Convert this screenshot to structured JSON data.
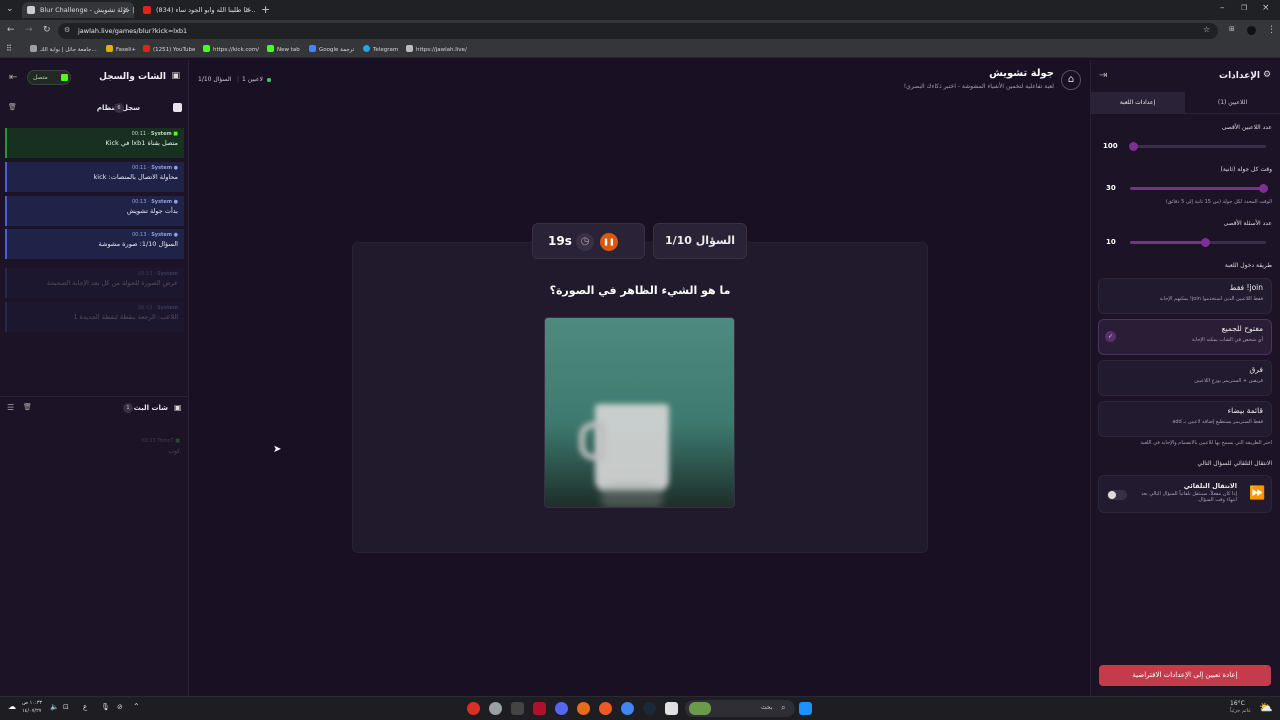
{
  "browser": {
    "tabs": [
      {
        "title": "Blur Challenge - جولة تشويش |",
        "active": true
      },
      {
        "title": "(834) حنا طلبنا الله وابو الجود ساء...",
        "active": false
      }
    ],
    "url": "jawlah.live/games/blur?kick=lxb1",
    "bookmarks": [
      {
        "label": "جامعة حائل | بوابة الك...",
        "color": "#9aa0a6"
      },
      {
        "label": "Faseli+",
        "color": "#e0b000"
      },
      {
        "label": "(1251) YouTube",
        "color": "#e62117"
      },
      {
        "label": "https://kick.com/",
        "color": "#53fc18"
      },
      {
        "label": "New tab",
        "color": "#53fc18"
      },
      {
        "label": "Google ترجمة",
        "color": "#4285f4"
      },
      {
        "label": "Telegram",
        "color": "#2aa3df"
      },
      {
        "label": "https://jawlah.live/",
        "color": "#bbbbbb"
      }
    ]
  },
  "left": {
    "title": "الشات والسجل",
    "connected": "متصل",
    "system_log_title": "سجل النظام",
    "system_log_count": "6",
    "logs": [
      {
        "who": "System",
        "time": "00:11",
        "msg": "متصل بقناة lxb1 في Kick",
        "color": "#2f8f3f",
        "bg": "#17301f"
      },
      {
        "who": "System",
        "time": "00:11",
        "msg": "محاولة الاتصال بالمنصات: kick",
        "color": "#4a63c8",
        "bg": "#1f2348"
      },
      {
        "who": "System",
        "time": "00:13",
        "msg": "بدأت جولة تشويش",
        "color": "#4a63c8",
        "bg": "#1f2348"
      },
      {
        "who": "System",
        "time": "00:13",
        "msg": "السؤال 1/10: صورة مشوشة",
        "color": "#4a63c8",
        "bg": "#1f2348"
      },
      {
        "who": "System",
        "time": "00:13",
        "msg": "عرض الصورة للجولة من كل بعد الإجابة الصحيحة",
        "color": "#4a63c8",
        "bg": "#1f2348",
        "faded": true
      },
      {
        "who": "System",
        "time": "00:13",
        "msg": "اللاعب: الرجعة بنقطة لنقطة الجديدة 1",
        "color": "#4a63c8",
        "bg": "#1f2348",
        "faded": true
      }
    ],
    "bot_chat_title": "شات البث",
    "bot_chat_count": "1",
    "bot_msg": {
      "who": "Tomo7",
      "time": "00:13",
      "msg": "كوب"
    }
  },
  "header": {
    "title": "جولة تشويش",
    "subtitle": "لعبة تفاعلية لتخمين الأشياء المشوشة - اختبر ذكاءك البصري!",
    "question_counter": "السؤال 1/10",
    "players": "1 لاعبين"
  },
  "game": {
    "question_label": "السؤال 1/10",
    "timer": "19s",
    "question": "ما هو الشيء الظاهر في الصورة؟",
    "image_icon": "blurred-mug-image"
  },
  "right": {
    "title": "الإعدادات",
    "tabs": [
      "اللاعبين (1)",
      "إعدادات اللعبة"
    ],
    "max_players_label": "عدد اللاعبين الأقصى",
    "max_players_value": "100",
    "max_players_fraction": 0.02,
    "round_time_label": "وقت كل جولة (ثانية)",
    "round_time_value": "30",
    "round_time_fraction": 0.98,
    "round_time_hint": "الوقت المحدد لكل جولة (من 15 ثانية إلى 5 دقائق)",
    "max_questions_label": "عدد الأسئلة الأقصى",
    "max_questions_value": "10",
    "max_questions_fraction": 0.55,
    "entry_mode_label": "طريقة دخول اللعبة",
    "modes": [
      {
        "title": "join! فقط",
        "desc": "فقط اللاعبين الذين استخدموا join! يمكنهم الإجابة",
        "selected": false
      },
      {
        "title": "مفتوح للجميع",
        "desc": "أي شخص في الشات يمكنه الإجابة",
        "selected": true
      },
      {
        "title": "فرق",
        "desc": "فريقين + الستريمر يوزع اللاعبين",
        "selected": false
      },
      {
        "title": "قائمة بيضاء",
        "desc": "فقط الستريمر يستطيع إضافة لاعبين بـ add",
        "selected": false
      }
    ],
    "mode_hint": "اختر الطريقة التي يسمح بها للاعبين بالانضمام والإجابة في اللعبة",
    "auto_next_label": "الانتقال التلقائي للسؤال التالي",
    "auto_next_title": "الانتقال التلقائي",
    "auto_next_desc": "إذا كان مفعلاً، سينتقل تلقائياً للسؤال التالي بعد انتهاء وقت السؤال.",
    "reset_button": "إعادة تعيين إلى الإعدادات الافتراضية"
  },
  "taskbar": {
    "search": "بحث",
    "weather_temp": "16°C",
    "weather_desc": "غائم جزئياً",
    "time": "١٠:٣٣ ص",
    "date": "١٤/٠٧/٢٧",
    "lang": "ع"
  },
  "colors": {
    "accent": "#7e2f95",
    "kick": "#53fc18",
    "reset": "#c43b4c",
    "timer_orange": "#d9570e"
  }
}
